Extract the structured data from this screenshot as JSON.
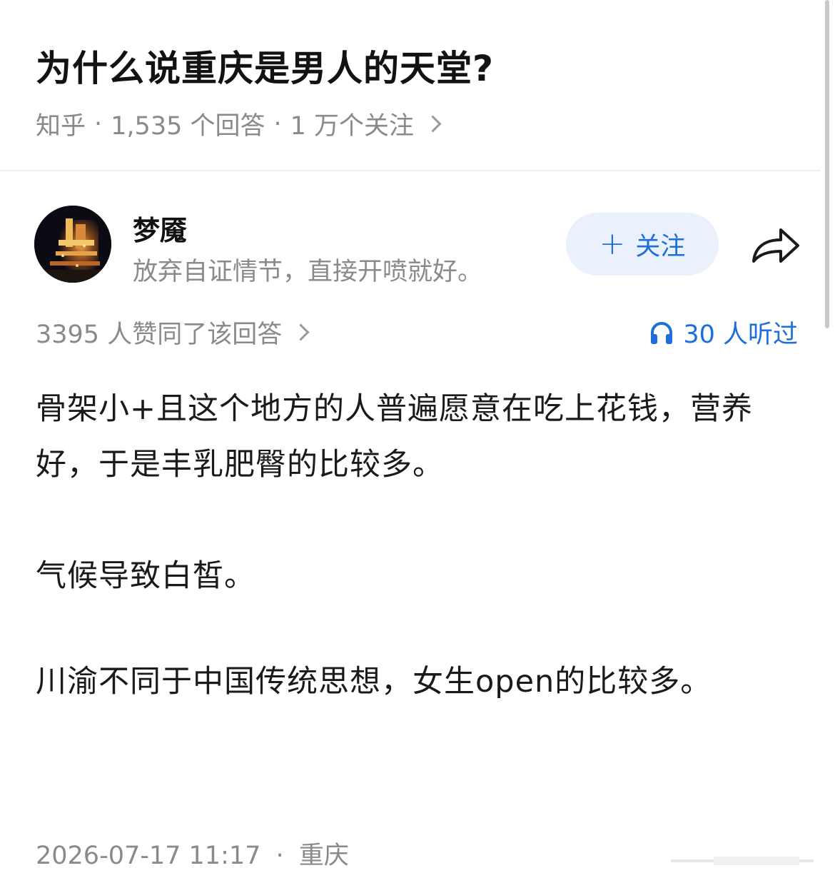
{
  "question": {
    "title": "为什么说重庆是男人的天堂?",
    "source": "知乎",
    "answers_count": "1,535 个回答",
    "followers_count": "1 万个关注",
    "separator": "·"
  },
  "author": {
    "name": "梦魇",
    "bio": "放弃自证情节，直接开喷就好。",
    "follow_label": "关注"
  },
  "answer": {
    "upvotes": "3395 人赞同了该回答",
    "listeners": "30 人听过",
    "paragraphs": [
      "骨架小+且这个地方的人普遍愿意在吃上花钱，营养好，于是丰乳肥臀的比较多。",
      "气候导致白皙。",
      "川渝不同于中国传统思想，女生open的比较多。"
    ],
    "date": "2026-07-17 11:17",
    "location": "重庆"
  },
  "colors": {
    "accent": "#1e6fd9",
    "follow_bg": "#eaf1fc",
    "meta_text": "#8a8a8a"
  },
  "icons": {
    "chevron": "chevron-right-icon",
    "plus": "plus-icon",
    "share": "share-icon",
    "headphones": "headphones-icon"
  }
}
